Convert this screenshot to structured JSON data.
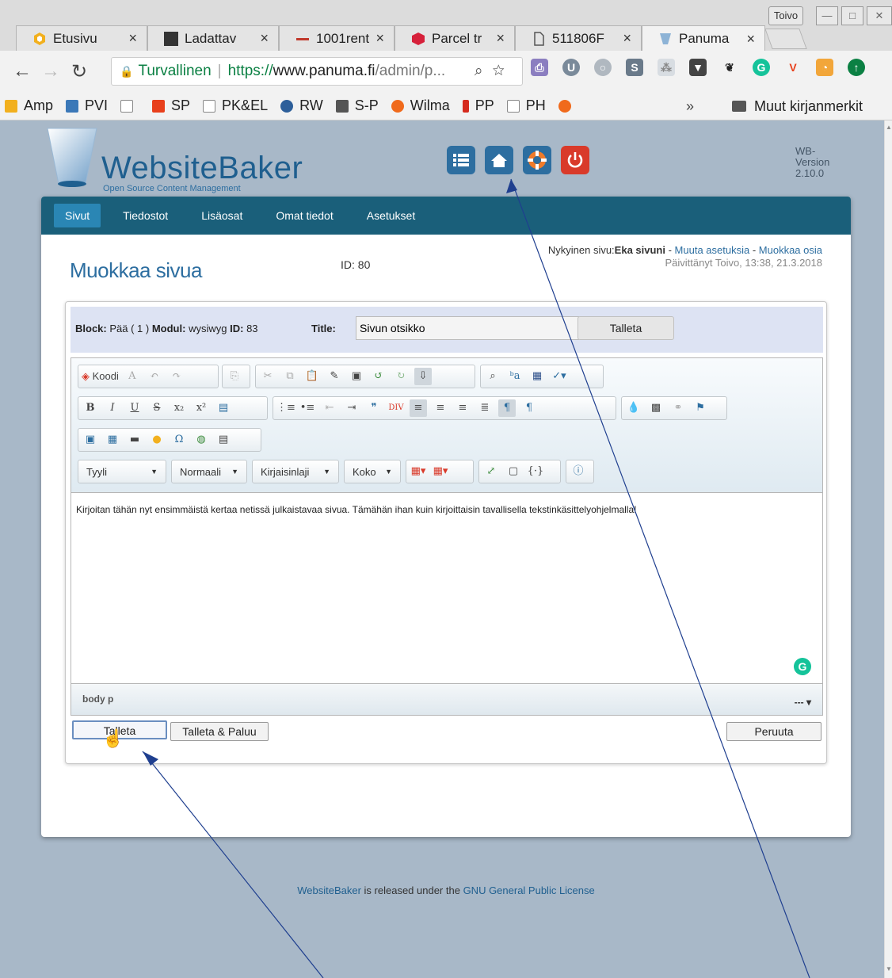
{
  "browser": {
    "profile_name": "Toivo",
    "tabs": [
      {
        "label": "Etusivu",
        "icon": "hexagon-icon"
      },
      {
        "label": "Ladattav",
        "icon": "image-icon"
      },
      {
        "label": "1001rent",
        "icon": "dash-icon"
      },
      {
        "label": "Parcel tr",
        "icon": "parcel-icon"
      },
      {
        "label": "511806F",
        "icon": "page-icon"
      },
      {
        "label": "Panuma",
        "icon": "wb-cup-icon"
      }
    ],
    "close_glyph": "×",
    "url": {
      "secure_label": "Turvallinen",
      "scheme": "https://",
      "host": "www.panuma.fi",
      "path": "/admin/p..."
    },
    "bookmarks": [
      {
        "label": "Amp",
        "color": "#f2b01e"
      },
      {
        "label": "PVI",
        "color": "#3b78b8"
      },
      {
        "label": "",
        "color": "#888888"
      },
      {
        "label": "SP",
        "color": "#e8401c"
      },
      {
        "label": "PK&EL",
        "color": "#888888"
      },
      {
        "label": "RW",
        "color": "#2d5f9a"
      },
      {
        "label": "S-P",
        "color": "#555555"
      },
      {
        "label": "Wilma",
        "color": "#f06a1c"
      },
      {
        "label": "PP",
        "color": "#d52b1e"
      },
      {
        "label": "PH",
        "color": "#888888"
      }
    ],
    "bookmarks_more": "»",
    "other_bookmarks": "Muut kirjanmerkit"
  },
  "wb": {
    "brand": "WebsiteBaker",
    "tagline": "Open Source Content Management",
    "version_line1": "WB-",
    "version_line2": "Version",
    "version_line3": "2.10.0",
    "menu": [
      "Sivut",
      "Tiedostot",
      "Lisäosat",
      "Omat tiedot",
      "Asetukset"
    ],
    "page_title": "Muokkaa sivua",
    "page_id": "ID: 80",
    "current_label": "Nykyinen sivu:",
    "current_page": "Eka sivuni",
    "link_settings": "Muuta asetuksia",
    "link_edit": "Muokkaa osia",
    "separator": " - ",
    "updated": "Päivittänyt Toivo, 13:38, 21.3.2018",
    "block_label": "Block:",
    "block_value": "Pää ( 1 )",
    "module_label": "Modul:",
    "module_value": "wysiwyg",
    "id_label": "ID:",
    "id_value": "83",
    "title_label": "Title:",
    "title_value": "Sivun otsikko",
    "title_save": "Talleta",
    "editor": {
      "source_button": "Koodi",
      "combos": [
        "Tyyli",
        "Normaali",
        "Kirjaisinlaji",
        "Koko"
      ],
      "content": "Kirjoitan tähän nyt ensimmäistä kertaa netissä julkaistavaa sivua. Tämähän ihan kuin kirjoittaisin tavallisella tekstinkäsittelyohjelmalla!",
      "path": "body  p",
      "path_right": "--- ▾"
    },
    "buttons": {
      "save": "Talleta",
      "save_back": "Talleta & Paluu",
      "cancel": "Peruuta"
    },
    "footer_brand": "WebsiteBaker",
    "footer_mid": " is released under the ",
    "footer_license": "GNU General Public License"
  }
}
